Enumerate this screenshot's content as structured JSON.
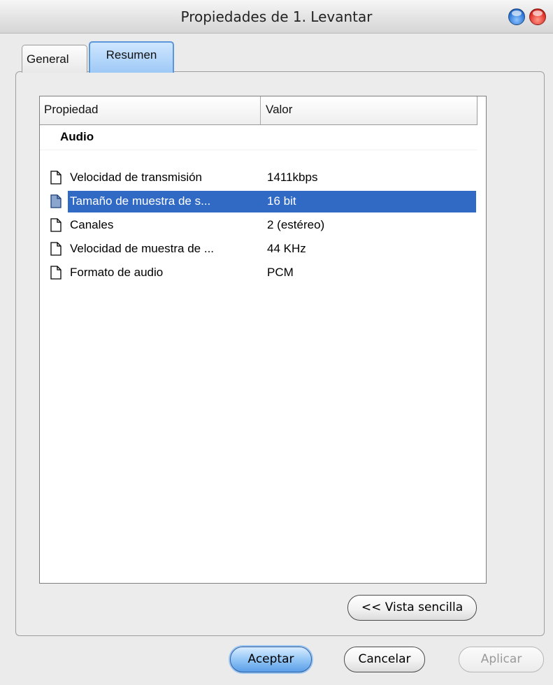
{
  "window": {
    "title": "Propiedades de 1. Levantar"
  },
  "tabs": [
    {
      "label": "General",
      "active": false
    },
    {
      "label": "Resumen",
      "active": true
    }
  ],
  "table": {
    "columns": [
      "Propiedad",
      "Valor"
    ],
    "group": "Audio",
    "rows": [
      {
        "property": "Velocidad de transmisión",
        "value": "1411kbps",
        "selected": false,
        "icon": "document-icon"
      },
      {
        "property": "Tamaño de muestra de s...",
        "value": "16 bit",
        "selected": true,
        "icon": "document-icon"
      },
      {
        "property": "Canales",
        "value": "2 (estéreo)",
        "selected": false,
        "icon": "document-icon"
      },
      {
        "property": "Velocidad de muestra de ...",
        "value": "44 KHz",
        "selected": false,
        "icon": "document-icon"
      },
      {
        "property": "Formato de audio",
        "value": "PCM",
        "selected": false,
        "icon": "document-icon"
      }
    ]
  },
  "buttons": {
    "simple_view": "<< Vista sencilla",
    "accept": "Aceptar",
    "cancel": "Cancelar",
    "apply": "Aplicar"
  },
  "colors": {
    "selection": "#316ac5",
    "active_tab": "#9ec9f6",
    "minimize_button": "#2f78d8",
    "close_button": "#e2332a"
  }
}
